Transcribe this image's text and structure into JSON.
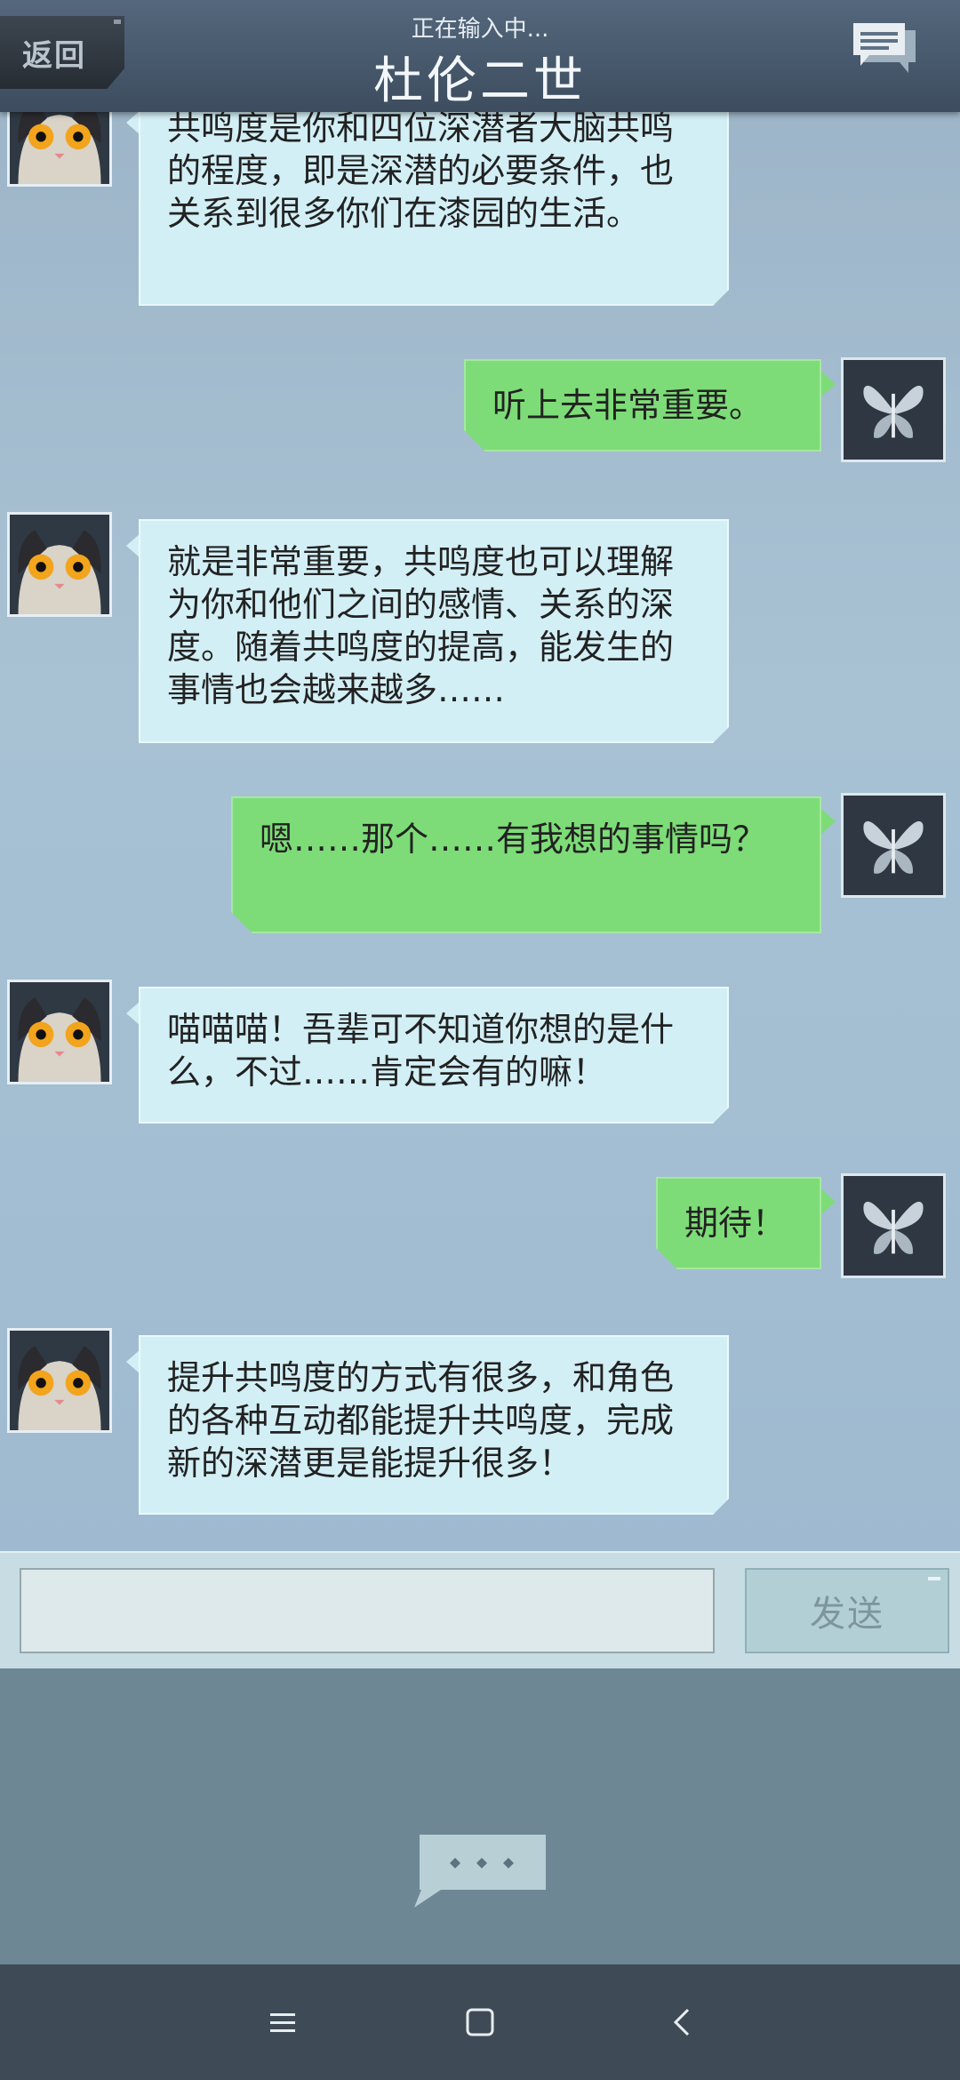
{
  "header": {
    "back_label": "返回",
    "typing_status": "正在输入中...",
    "title": "杜伦二世"
  },
  "messages": [
    {
      "sender": "cat",
      "text": "共鸣度是你和四位深潜者大脑共鸣的程度，即是深潜的必要条件，也关系到很多你们在漆园的生活。"
    },
    {
      "sender": "player",
      "text": "听上去非常重要。"
    },
    {
      "sender": "cat",
      "text": "就是非常重要，共鸣度也可以理解为你和他们之间的感情、关系的深度。随着共鸣度的提高，能发生的事情也会越来越多……"
    },
    {
      "sender": "player",
      "text": "嗯……那个……有我想的事情吗？"
    },
    {
      "sender": "cat",
      "text": "喵喵喵！吾辈可不知道你想的是什么，不过……肯定会有的嘛！"
    },
    {
      "sender": "player",
      "text": "期待！"
    },
    {
      "sender": "cat",
      "text": "提升共鸣度的方式有很多，和角色的各种互动都能提升共鸣度，完成新的深潜更是能提升很多！"
    }
  ],
  "input": {
    "value": "",
    "placeholder": ""
  },
  "send_label": "发送",
  "icons": {
    "header_right": "chat-bubbles-icon",
    "panel": "more-options-icon",
    "nav": [
      "menu-icon",
      "home-icon",
      "back-arrow-icon"
    ]
  },
  "colors": {
    "left_bubble": "#d3eff6",
    "right_bubble": "#7ddc77",
    "header": "#46576a"
  }
}
